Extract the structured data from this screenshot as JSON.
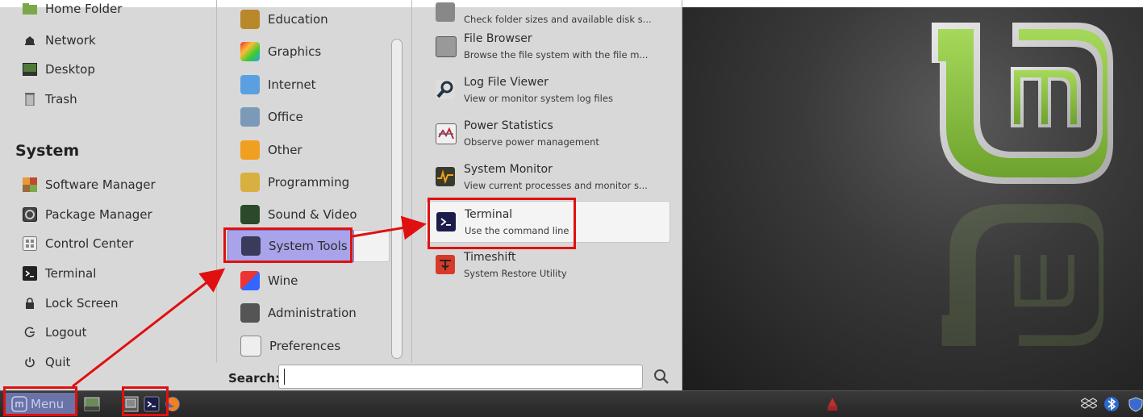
{
  "places": [
    {
      "label": "Home Folder",
      "icon": "home-folder-icon"
    },
    {
      "label": "Network",
      "icon": "network-icon"
    },
    {
      "label": "Desktop",
      "icon": "desktop-icon"
    },
    {
      "label": "Trash",
      "icon": "trash-icon"
    }
  ],
  "system": {
    "title": "System",
    "items": [
      {
        "label": "Software Manager",
        "icon": "software-manager-icon"
      },
      {
        "label": "Package Manager",
        "icon": "package-manager-icon"
      },
      {
        "label": "Control Center",
        "icon": "control-center-icon"
      },
      {
        "label": "Terminal",
        "icon": "terminal-icon"
      },
      {
        "label": "Lock Screen",
        "icon": "lock-icon"
      },
      {
        "label": "Logout",
        "icon": "logout-icon"
      },
      {
        "label": "Quit",
        "icon": "power-icon"
      }
    ]
  },
  "categories": [
    {
      "label": "Education",
      "icon": "education-icon"
    },
    {
      "label": "Graphics",
      "icon": "graphics-icon"
    },
    {
      "label": "Internet",
      "icon": "internet-icon"
    },
    {
      "label": "Office",
      "icon": "office-icon"
    },
    {
      "label": "Other",
      "icon": "other-icon"
    },
    {
      "label": "Programming",
      "icon": "programming-icon"
    },
    {
      "label": "Sound & Video",
      "icon": "sound-video-icon"
    },
    {
      "label": "System Tools",
      "icon": "system-tools-icon",
      "selected": true
    },
    {
      "label": "Wine",
      "icon": "wine-icon"
    },
    {
      "label": "Administration",
      "icon": "administration-icon"
    },
    {
      "label": "Preferences",
      "icon": "preferences-icon"
    }
  ],
  "apps": [
    {
      "name": "",
      "description": "Check folder sizes and available disk s...",
      "icon": "disk-usage-icon"
    },
    {
      "name": "File Browser",
      "description": "Browse the file system with the file m...",
      "icon": "file-browser-icon"
    },
    {
      "name": "Log File Viewer",
      "description": "View or monitor system log files",
      "icon": "log-viewer-icon"
    },
    {
      "name": "Power Statistics",
      "description": "Observe power management",
      "icon": "power-statistics-icon"
    },
    {
      "name": "System Monitor",
      "description": "View current processes and monitor s...",
      "icon": "system-monitor-icon"
    },
    {
      "name": "Terminal",
      "description": "Use the command line",
      "icon": "terminal-icon",
      "selected": true
    },
    {
      "name": "Timeshift",
      "description": "System Restore Utility",
      "icon": "timeshift-icon"
    }
  ],
  "search": {
    "label": "Search:",
    "value": ""
  },
  "taskbar": {
    "menu_label": "Menu"
  },
  "colors": {
    "selection": "#a9a3ea",
    "annotation": "#e01010",
    "mint_green": "#8cc63f",
    "taskbar": "#2e2e2e"
  }
}
